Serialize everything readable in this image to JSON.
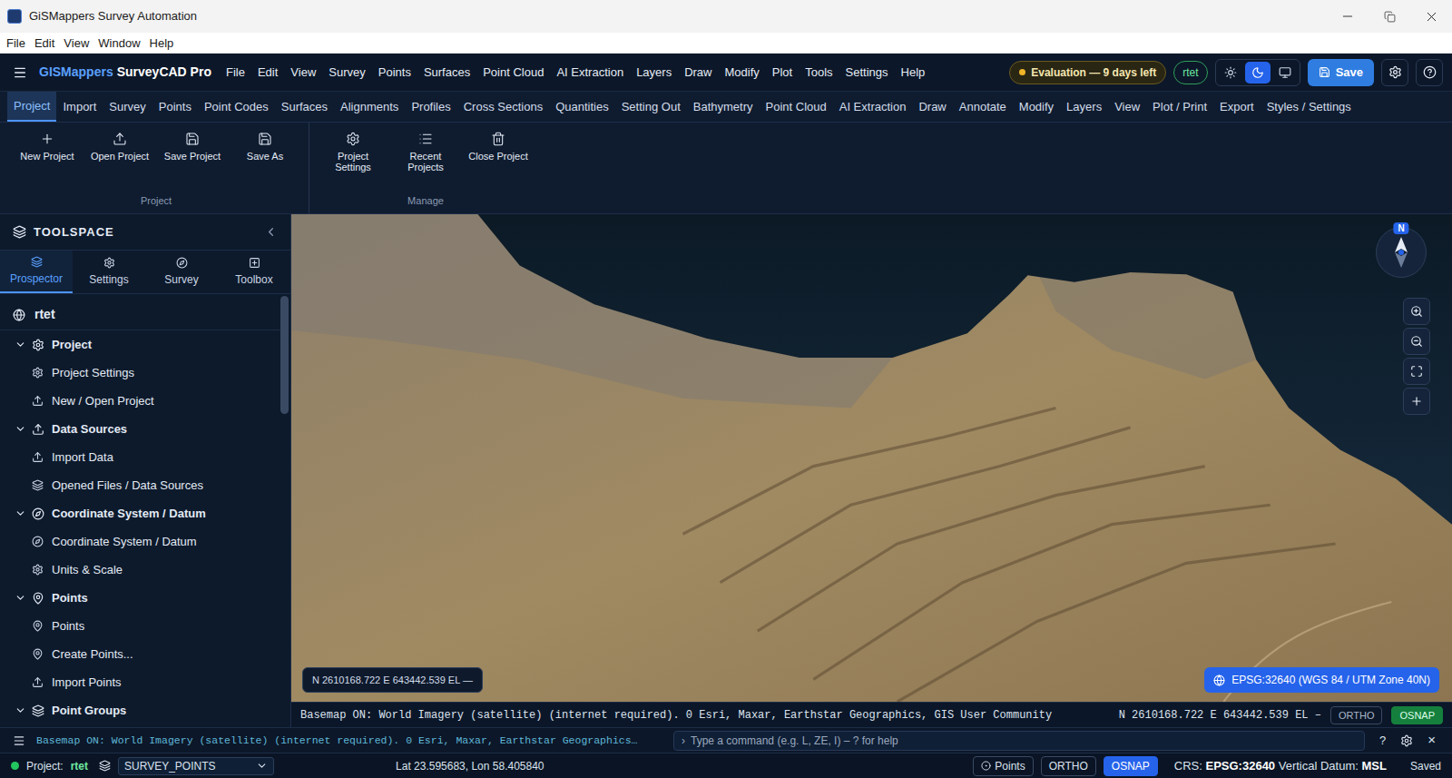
{
  "window": {
    "title": "GiSMappers Survey Automation"
  },
  "os_menu": [
    "File",
    "Edit",
    "View",
    "Window",
    "Help"
  ],
  "header": {
    "brand": {
      "name": "GISMappers",
      "product": "SurveyCAD Pro"
    },
    "menu": [
      "File",
      "Edit",
      "View",
      "Survey",
      "Points",
      "Surfaces",
      "Point Cloud",
      "AI Extraction",
      "Layers",
      "Draw",
      "Modify",
      "Plot",
      "Tools",
      "Settings",
      "Help"
    ],
    "evaluation": "Evaluation — 9 days left",
    "project_badge": "rtet",
    "theme_modes": [
      {
        "kind": "light",
        "selected": false
      },
      {
        "kind": "dark",
        "selected": true
      },
      {
        "kind": "system",
        "selected": false
      }
    ],
    "save": "Save"
  },
  "ribbon_tabs": [
    {
      "label": "Project",
      "selected": true
    },
    {
      "label": "Import",
      "selected": false
    },
    {
      "label": "Survey",
      "selected": false
    },
    {
      "label": "Points",
      "selected": false
    },
    {
      "label": "Point Codes",
      "selected": false
    },
    {
      "label": "Surfaces",
      "selected": false
    },
    {
      "label": "Alignments",
      "selected": false
    },
    {
      "label": "Profiles",
      "selected": false
    },
    {
      "label": "Cross Sections",
      "selected": false
    },
    {
      "label": "Quantities",
      "selected": false
    },
    {
      "label": "Setting Out",
      "selected": false
    },
    {
      "label": "Bathymetry",
      "selected": false
    },
    {
      "label": "Point Cloud",
      "selected": false
    },
    {
      "label": "AI Extraction",
      "selected": false
    },
    {
      "label": "Draw",
      "selected": false
    },
    {
      "label": "Annotate",
      "selected": false
    },
    {
      "label": "Modify",
      "selected": false
    },
    {
      "label": "Layers",
      "selected": false
    },
    {
      "label": "View",
      "selected": false
    },
    {
      "label": "Plot / Print",
      "selected": false
    },
    {
      "label": "Export",
      "selected": false
    },
    {
      "label": "Styles / Settings",
      "selected": false
    }
  ],
  "ribbon_groups": [
    {
      "label": "Project",
      "buttons": [
        "New Project",
        "Open Project",
        "Save Project",
        "Save As"
      ]
    },
    {
      "label": "Manage",
      "buttons": [
        "Project\nSettings",
        "Recent\nProjects",
        "Close Project"
      ]
    }
  ],
  "toolspace": {
    "title": "TOOLSPACE",
    "tabs": [
      {
        "label": "Prospector",
        "selected": true
      },
      {
        "label": "Settings",
        "selected": false
      },
      {
        "label": "Survey",
        "selected": false
      },
      {
        "label": "Toolbox",
        "selected": false
      }
    ],
    "root": "rtet",
    "sections": [
      {
        "label": "Project",
        "expanded": true,
        "items": [
          "Project Settings",
          "New / Open Project"
        ]
      },
      {
        "label": "Data Sources",
        "expanded": true,
        "items": [
          "Import Data",
          "Opened Files / Data Sources"
        ]
      },
      {
        "label": "Coordinate System / Datum",
        "expanded": true,
        "items": [
          "Coordinate System / Datum",
          "Units & Scale"
        ]
      },
      {
        "label": "Points",
        "expanded": true,
        "items": [
          "Points",
          "Create Points...",
          "Import Points"
        ]
      },
      {
        "label": "Point Groups",
        "expanded": true,
        "items": []
      }
    ]
  },
  "map": {
    "compass": "N",
    "coordinates": "N 2610168.722 E 643442.539 EL —",
    "crs_badge": "EPSG:32640 (WGS 84 / UTM Zone 40N)"
  },
  "map_status": {
    "message": "Basemap ON: World Imagery (satellite) (internet required). 0 Esri, Maxar, Earthstar Geographics, GIS User Community",
    "coordinates": "N 2610168.722 E 643442.539 EL –",
    "toggles": [
      {
        "label": "ORTHO",
        "on": false
      },
      {
        "label": "OSNAP",
        "on": true
      }
    ]
  },
  "command_line": {
    "message": "Basemap ON: World Imagery (satellite) (internet required). 0 Esri, Maxar, Earthstar Geographics…",
    "prompt": "›",
    "placeholder": "Type a command (e.g. L, ZE, I) – ? for help",
    "help": "?",
    "close": "×"
  },
  "status_bar": {
    "online": true,
    "project_label": "Project:",
    "project": "rtet",
    "layer": "SURVEY_POINTS",
    "latlon": "Lat 23.595683, Lon 58.405840",
    "toggles": [
      {
        "label": "Points",
        "on": false
      },
      {
        "label": "ORTHO",
        "on": false
      },
      {
        "label": "OSNAP",
        "on": true
      }
    ],
    "crs_label": "CRS:",
    "crs": "EPSG:32640",
    "vdatum_label": "Vertical Datum:",
    "vdatum": "MSL",
    "saved": "Saved"
  }
}
